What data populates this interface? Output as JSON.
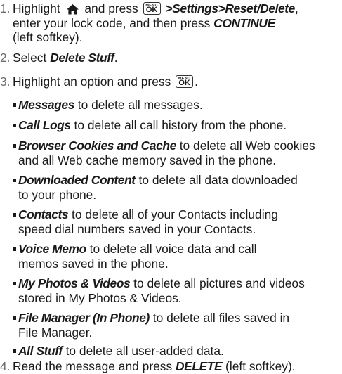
{
  "key": {
    "top": "MENU",
    "bottom": "OK"
  },
  "steps": [
    {
      "num": "1.",
      "t1": "Highlight",
      "t2": "and press",
      "t3": ">Settings>Reset/Delete",
      "t4": ",",
      "t5": "enter your lock code, and then press",
      "t6": "CONTINUE",
      "t7": "(left softkey)."
    },
    {
      "num": "2.",
      "t1": "Select",
      "t2": "Delete Stuff",
      "t3": "."
    },
    {
      "num": "3.",
      "t1": "Highlight an option and press",
      "t2": "."
    },
    {
      "num": "4.",
      "t1": "Read the message and press",
      "t2": "DELETE",
      "t3": "(left softkey)."
    }
  ],
  "options": [
    {
      "name": "Messages",
      "l1": "to delete all messages.",
      "l2": ""
    },
    {
      "name": "Call Logs",
      "l1": "to delete all call history from the phone.",
      "l2": ""
    },
    {
      "name": "Browser Cookies and Cache",
      "l1": "to delete all Web cookies",
      "l2": "and all Web cache memory saved in the phone."
    },
    {
      "name": "Downloaded Content",
      "l1": "to delete all data downloaded",
      "l2": "to your phone."
    },
    {
      "name": "Contacts",
      "l1": "to delete all of your Contacts including",
      "l2": "speed dial numbers saved in your Contacts."
    },
    {
      "name": "Voice Memo",
      "l1": "to delete all voice data and call",
      "l2": "memos saved in the phone."
    },
    {
      "name": "My Photos & Videos",
      "l1": "to delete all pictures and videos",
      "l2": "stored in My Photos & Videos."
    },
    {
      "name": "File Manager (In Phone)",
      "l1": "to delete all files saved in",
      "l2": "File Manager."
    },
    {
      "name": "All Stuff",
      "l1": "to delete all user-added data.",
      "l2": ""
    }
  ]
}
